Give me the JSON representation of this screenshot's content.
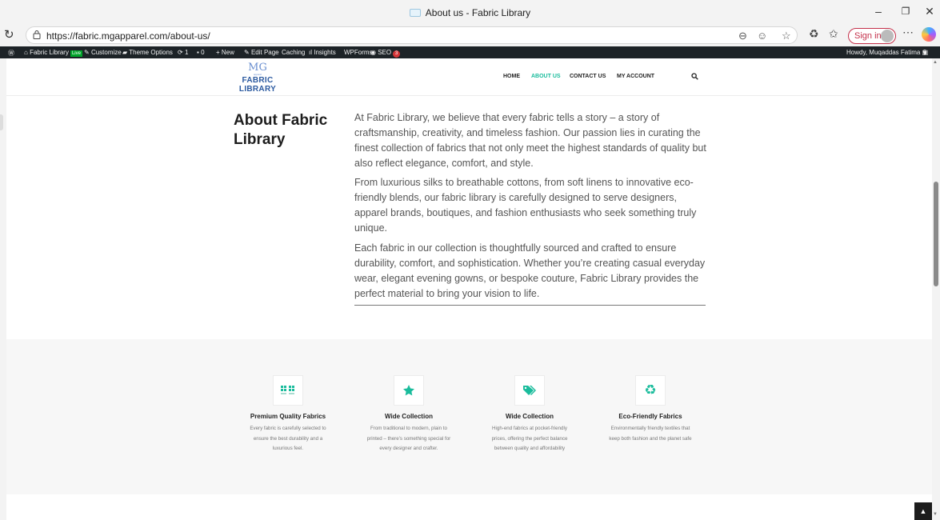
{
  "browser": {
    "window_title": "About us - Fabric Library",
    "url": "https://fabric.mgapparel.com/about-us/",
    "sign_in": "Sign in"
  },
  "adminbar": {
    "site": "Fabric Library",
    "live": "Live",
    "customize": "Customize",
    "theme_options": "Theme Options",
    "updates": "1",
    "comments": "0",
    "new": "New",
    "edit_page": "Edit Page",
    "caching": "Caching",
    "insights": "Insights",
    "wpforms": "WPForms",
    "seo": "SEO",
    "seo_count": "3",
    "howdy": "Howdy, Muqaddas Fatima"
  },
  "site": {
    "logo_mark": "MG",
    "logo_sub": "apparel",
    "logo_name": "FABRIC LIBRARY",
    "nav": [
      "HOME",
      "ABOUT US",
      "CONTACT US",
      "MY ACCOUNT"
    ]
  },
  "about": {
    "heading": "About Fabric Library",
    "paragraphs": [
      "At Fabric Library, we believe that every fabric tells a story – a story of craftsmanship, creativity, and timeless fashion. Our passion lies in curating the finest collection of fabrics that not only meet the highest standards of quality but also reflect elegance, comfort, and style.",
      "From luxurious silks to breathable cottons, from soft linens to innovative eco-friendly blends, our fabric library is carefully designed to serve designers, apparel brands, boutiques, and fashion enthusiasts who seek something truly unique.",
      "Each fabric in our collection is thoughtfully sourced and crafted to ensure durability, comfort, and sophistication. Whether you’re creating casual everyday wear, elegant evening gowns, or bespoke couture, Fabric Library provides the perfect material to bring your vision to life."
    ]
  },
  "features": [
    {
      "icon": "grid-icon",
      "title": "Premium Quality Fabrics",
      "desc": "Every fabric is carefully selected to ensure the best durability and a luxurious feel."
    },
    {
      "icon": "star-icon",
      "title": "Wide Collection",
      "desc": "From traditional to modern, plain to printed – there’s something special for every designer and crafter."
    },
    {
      "icon": "tags-icon",
      "title": "Wide Collection",
      "desc": "High-end fabrics at pocket-friendly prices, offering the perfect balance between quality and affordability"
    },
    {
      "icon": "recycle-icon",
      "title": "Eco-Friendly Fabrics",
      "desc": "Environmentally friendly textiles that keep both fashion and the planet safe"
    }
  ],
  "colors": {
    "accent": "#1abc9c",
    "adminbar": "#1d2327",
    "logo": "#2c5aa0"
  }
}
